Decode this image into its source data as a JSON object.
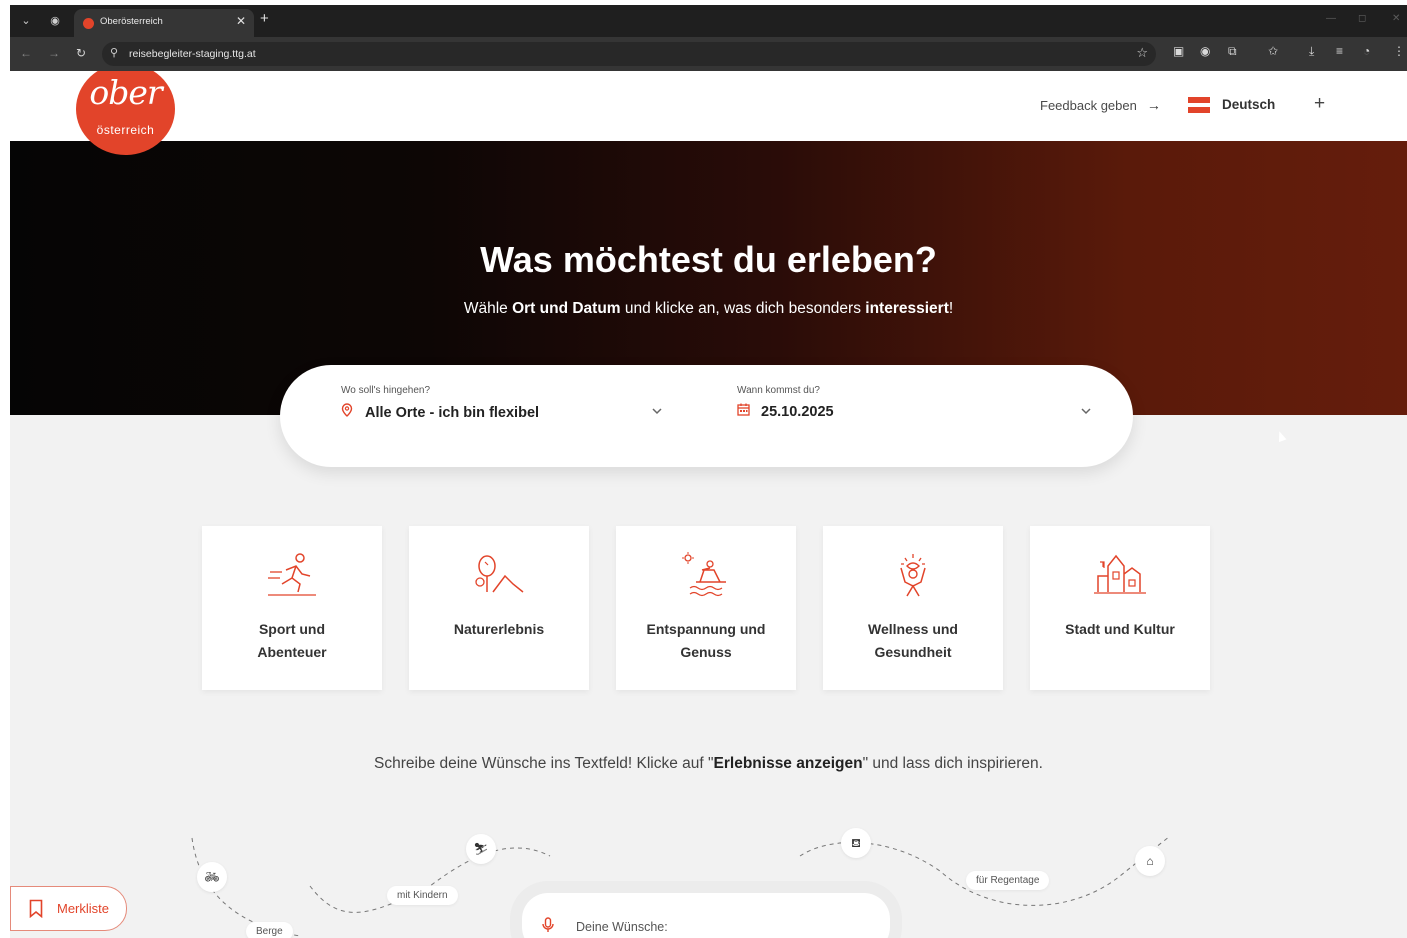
{
  "browser": {
    "tab_title": "Oberösterreich",
    "url": "reisebegleiter-staging.ttg.at"
  },
  "header": {
    "logo_main": "ober",
    "logo_sub": "österreich",
    "feedback_label": "Feedback geben",
    "language_label": "Deutsch"
  },
  "hero": {
    "title": "Was möchtest du erleben?",
    "subtitle_parts": [
      "Wähle ",
      "Ort und Datum",
      " und klicke an, was dich besonders ",
      "interessiert",
      "!"
    ]
  },
  "search": {
    "location_label": "Wo soll's hingehen?",
    "location_value": "Alle Orte - ich bin flexibel",
    "date_label": "Wann kommst du?",
    "date_value": "25.10.2025"
  },
  "categories": [
    {
      "line1": "Sport und",
      "line2": "Abenteuer",
      "icon": "sport-icon"
    },
    {
      "line1": "Naturerlebnis",
      "line2": "",
      "icon": "nature-icon"
    },
    {
      "line1": "Entspannung und",
      "line2": "Genuss",
      "icon": "relax-icon"
    },
    {
      "line1": "Wellness und",
      "line2": "Gesundheit",
      "icon": "wellness-icon"
    },
    {
      "line1": "Stadt und Kultur",
      "line2": "",
      "icon": "city-icon"
    }
  ],
  "hint": {
    "parts": [
      "Schreibe deine Wünsche ins Textfeld! Klicke auf \"",
      "Erlebnisse anzeigen",
      "\" und lass dich inspirieren."
    ]
  },
  "route_chips": {
    "kids": "mit Kindern",
    "berge": "Berge",
    "rain": "für Regentage"
  },
  "wishes": {
    "placeholder": "Deine Wünsche:"
  },
  "merkliste": {
    "label": "Merkliste"
  },
  "colors": {
    "brand": "#e2442a",
    "hero_dark": "#050505",
    "hero_warm": "#651d0c"
  }
}
